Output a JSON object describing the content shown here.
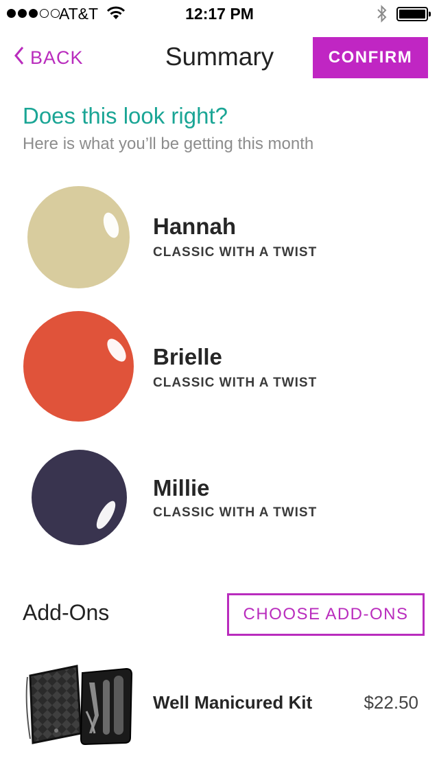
{
  "status_bar": {
    "carrier": "AT&T",
    "time": "12:17 PM",
    "signal_bars": 3,
    "signal_total": 5
  },
  "nav": {
    "back_label": "BACK",
    "title": "Summary",
    "confirm_label": "CONFIRM"
  },
  "intro": {
    "headline": "Does this look right?",
    "subtitle": "Here is what you’ll be getting this month"
  },
  "polishes": [
    {
      "name": "Hannah",
      "collection": "CLASSIC WITH A TWIST",
      "color": "#d8cc9e"
    },
    {
      "name": "Brielle",
      "collection": "CLASSIC WITH A TWIST",
      "color": "#e0533a"
    },
    {
      "name": "Millie",
      "collection": "CLASSIC WITH A TWIST",
      "color": "#39344f"
    }
  ],
  "addons": {
    "title": "Add-Ons",
    "choose_label": "CHOOSE ADD-ONS",
    "items": [
      {
        "name": "Well Manicured Kit",
        "price": "$22.50"
      }
    ]
  },
  "colors": {
    "accent": "#c026c3",
    "headline": "#1aa595"
  }
}
